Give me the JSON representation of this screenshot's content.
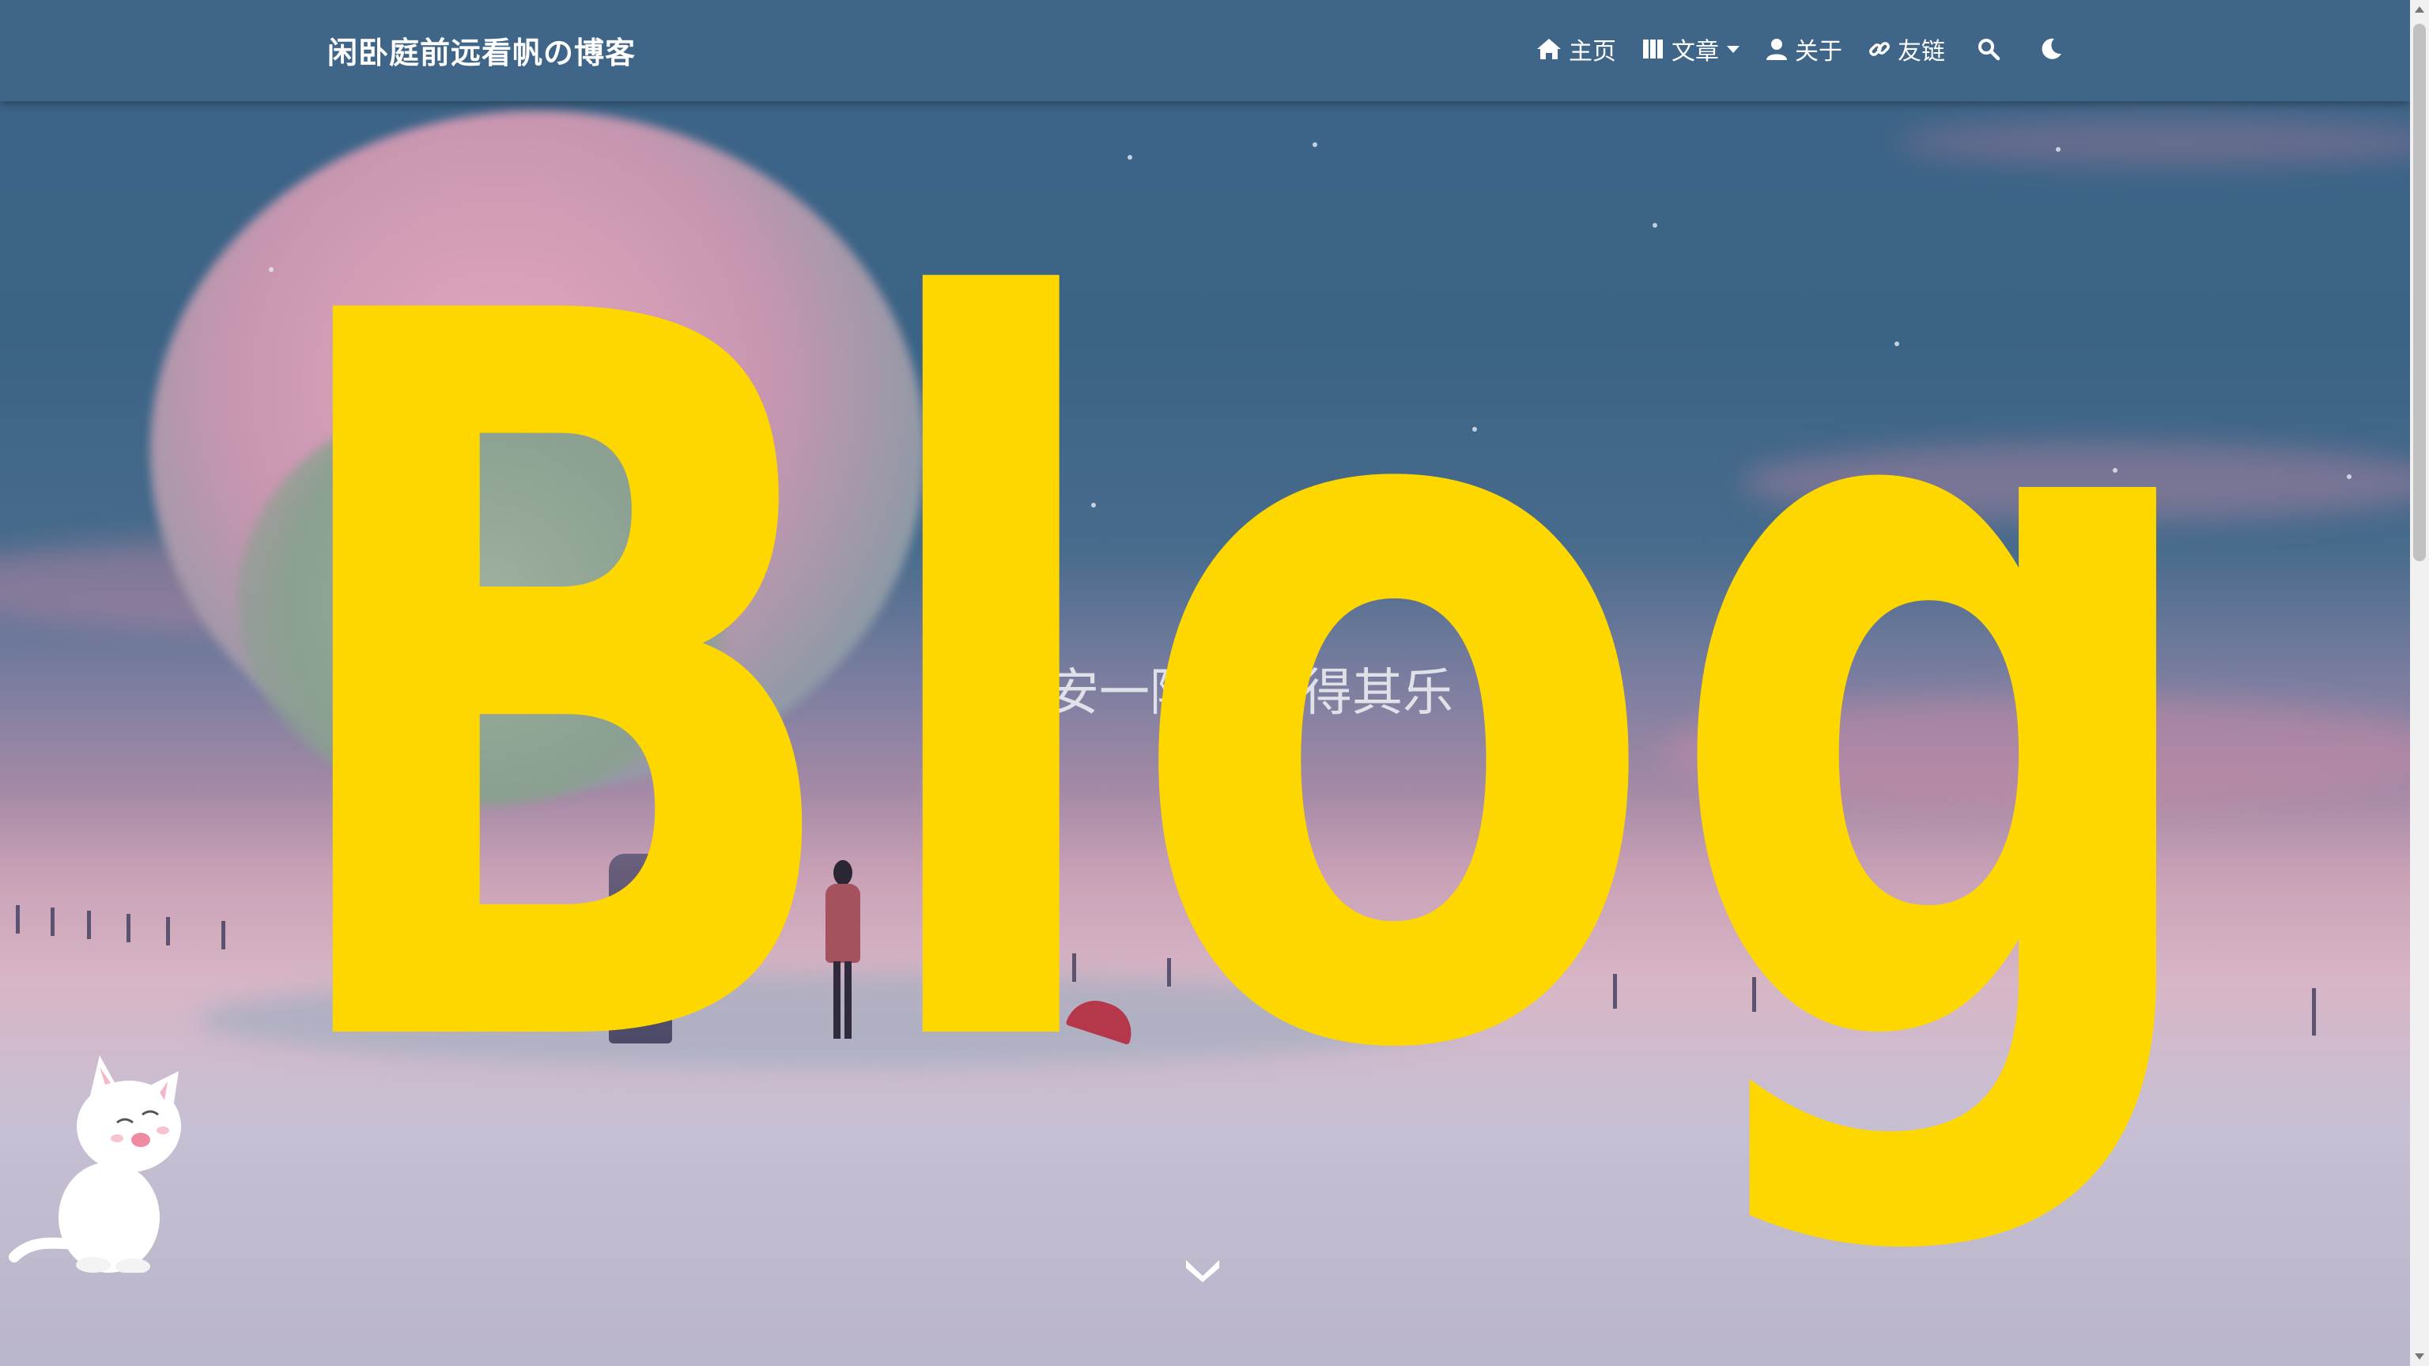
{
  "navbar": {
    "brand": "闲卧庭前远看帆の博客",
    "items": [
      {
        "icon": "home-icon",
        "label": "主页"
      },
      {
        "icon": "books-icon",
        "label": "文章",
        "dropdown": true
      },
      {
        "icon": "user-icon",
        "label": "关于"
      },
      {
        "icon": "link-icon",
        "label": "友链"
      }
    ],
    "search_icon": "search-icon",
    "theme_toggle_icon": "moon-icon"
  },
  "hero": {
    "overlay_text": "Blog",
    "overlay_color": "#FFD700",
    "subtitle": "偏安一隅，自得其乐",
    "scroll_icon": "chevron-down-icon"
  },
  "mascot": {
    "icon": "cat-icon"
  },
  "colors": {
    "navbar_bg": "#3f6589",
    "text": "#ffffff",
    "accent": "#FFD700"
  }
}
